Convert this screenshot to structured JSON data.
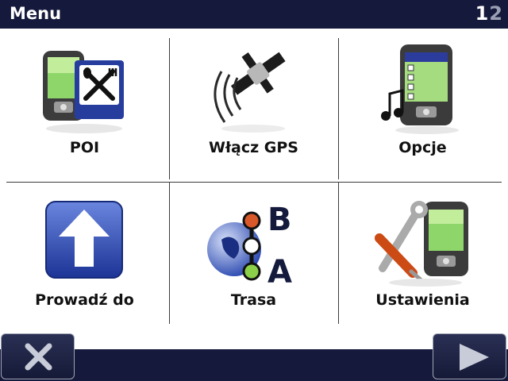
{
  "header": {
    "title": "Menu",
    "page_current": "1",
    "page_total": "2"
  },
  "menu": {
    "items": [
      {
        "label": "POI",
        "icon": "poi-icon"
      },
      {
        "label": "Włącz GPS",
        "icon": "satellite-icon"
      },
      {
        "label": "Opcje",
        "icon": "options-device-icon"
      },
      {
        "label": "Prowadź do",
        "icon": "navigate-arrow-icon"
      },
      {
        "label": "Trasa",
        "icon": "route-ab-icon"
      },
      {
        "label": "Ustawienia",
        "icon": "settings-tools-icon"
      }
    ]
  },
  "footer": {
    "close_icon": "close-icon",
    "next_icon": "next-arrow-icon"
  },
  "colors": {
    "bar": "#151a3c",
    "background": "#ffffff",
    "accent_green": "#7ed44a",
    "accent_blue": "#2a4ab8"
  }
}
